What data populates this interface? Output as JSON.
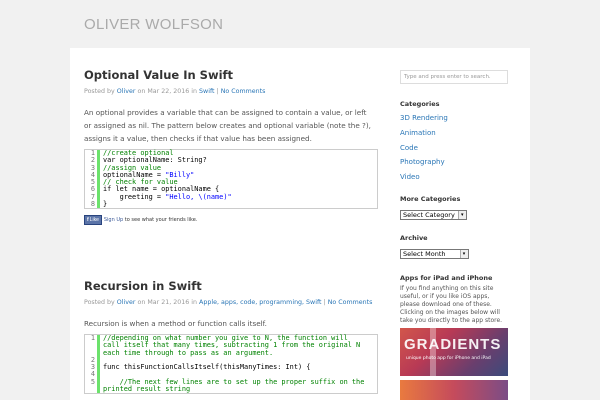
{
  "site": {
    "title": "OLIVER WOLFSON"
  },
  "posts": [
    {
      "title": "Optional Value In Swift",
      "meta": {
        "posted_by": "Posted by",
        "author": "Oliver",
        "on": "on",
        "date": "Mar 22, 2016",
        "in": "in",
        "categories": "Swift",
        "sep": "|",
        "comments": "No Comments"
      },
      "excerpt": "An optional provides a variable that can be assigned to contain a value, or left or assigned as nil. The pattern below creates and optional variable (note the ?), assigns it a value, then checks if that value has been assigned.",
      "code": [
        {
          "n": "1",
          "text": "//create optional"
        },
        {
          "n": "2",
          "text": "var optionalName: String?"
        },
        {
          "n": "3",
          "text": "//assign value"
        },
        {
          "n": "4",
          "text": "optionalName = \"Billy\""
        },
        {
          "n": "5",
          "text": "// check for value"
        },
        {
          "n": "6",
          "text": "if let name = optionalName {"
        },
        {
          "n": "7",
          "text": "    greeting = \"Hello, \\(name)\""
        },
        {
          "n": "8",
          "text": "}"
        }
      ],
      "like": {
        "button": "Like",
        "signup": "Sign Up",
        "text": "to see what your friends like."
      }
    },
    {
      "title": "Recursion in Swift",
      "meta": {
        "posted_by": "Posted by",
        "author": "Oliver",
        "on": "on",
        "date": "Mar 21, 2016",
        "in": "in",
        "categories": "Apple, apps, code, programming, Swift",
        "sep": "|",
        "comments": "No Comments"
      },
      "excerpt": "Recursion is when a method or function calls itself.",
      "code": [
        {
          "n": "1",
          "text": "//depending on what number you give to N, the function will"
        },
        {
          "n": "",
          "text": "call itself that many times, subtracting 1 from the original N"
        },
        {
          "n": "",
          "text": "each time through to pass as an argument."
        },
        {
          "n": "2",
          "text": ""
        },
        {
          "n": "3",
          "text": "func thisFunctionCallsItself(thisManyTimes: Int) {"
        },
        {
          "n": "4",
          "text": ""
        },
        {
          "n": "5",
          "text": "    //The next few lines are to set up the proper suffix on the"
        },
        {
          "n": "",
          "text": "printed result string"
        }
      ]
    }
  ],
  "sidebar": {
    "search_placeholder": "Type and press enter to search.",
    "categories_title": "Categories",
    "categories": [
      "3D Rendering",
      "Animation",
      "Code",
      "Photography",
      "Video"
    ],
    "more_title": "More Categories",
    "more_select": "Select Category",
    "archive_title": "Archive",
    "archive_select": "Select Month",
    "apps_title": "Apps for iPad and iPhone",
    "apps_text": "If you find anything on this site useful, or if you like iOS apps, please download one of these. Clicking on the images below will take you directly to the app store.",
    "banner_title": "GRADIENTS",
    "banner_sub": "unique photo app for iPhone and iPad"
  }
}
